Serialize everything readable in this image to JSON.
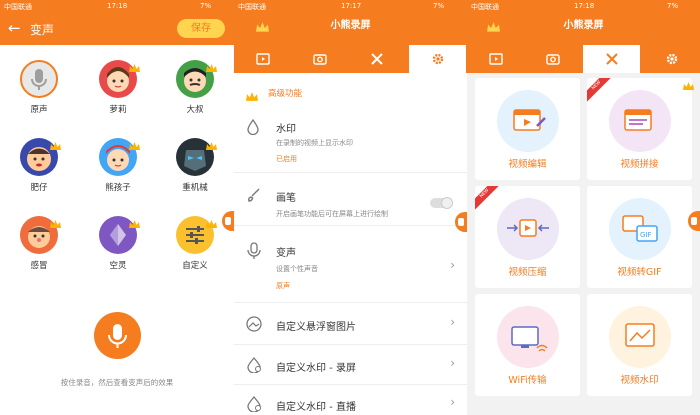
{
  "status": {
    "p1": {
      "carrier": "中国联通",
      "time": "17:18",
      "battery": "7%"
    },
    "p2": {
      "carrier": "中国联通",
      "time": "17:17",
      "battery": "7%"
    },
    "p3": {
      "carrier": "中国联通",
      "time": "17:18",
      "battery": "7%"
    }
  },
  "voice_screen": {
    "title": "变声",
    "save_label": "保存",
    "voices": [
      "原声",
      "萝莉",
      "大叔",
      "肥仔",
      "熊孩子",
      "重机械",
      "感冒",
      "空灵",
      "自定义"
    ],
    "hint": "按住录音，然后查看变声后的效果"
  },
  "app": {
    "title": "小熊录屏",
    "accent": "#f57c1f"
  },
  "tabs": [
    "video-icon",
    "camera-icon",
    "tools-icon",
    "gear-icon"
  ],
  "settings": {
    "section_title": "高级功能",
    "watermark": {
      "title": "水印",
      "subtitle": "在录制的视频上显示水印",
      "status": "已启用"
    },
    "brush": {
      "title": "画笔",
      "subtitle": "开启画笔功能后可在屏幕上进行绘制"
    },
    "voice_change": {
      "title": "变声",
      "subtitle": "设置个性声音",
      "status": "原声"
    },
    "float_image": {
      "title": "自定义悬浮窗图片"
    },
    "wm_record": {
      "title": "自定义水印 - 录屏"
    },
    "wm_live": {
      "title": "自定义水印 - 直播"
    }
  },
  "tools": {
    "items": [
      "视频编辑",
      "视频拼接",
      "视频压缩",
      "视频转GIF",
      "WiFi传输",
      "视频水印"
    ],
    "new_badge": "NEW"
  }
}
